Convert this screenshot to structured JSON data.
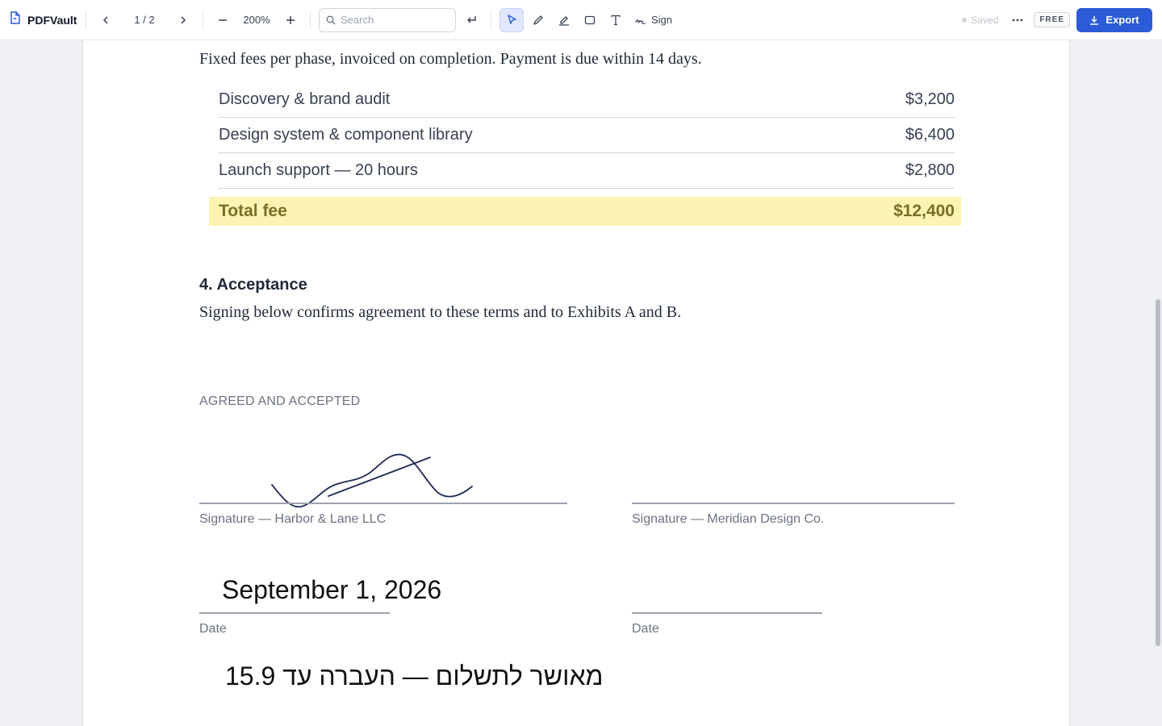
{
  "toolbar": {
    "app_name": "PDFVault",
    "page_indicator": "1 / 2",
    "zoom": "200%",
    "search_placeholder": "Search",
    "sign_label": "Sign",
    "saved_label": "Saved",
    "plan_badge": "FREE",
    "export_label": "Export",
    "icons": [
      "file-icon",
      "chevron-left-icon",
      "chevron-right-icon",
      "minus-icon",
      "plus-icon",
      "search-icon",
      "return-icon",
      "cursor-icon",
      "pen-icon",
      "highlighter-icon",
      "rectangle-icon",
      "text-icon",
      "signature-icon",
      "more-icon",
      "download-icon"
    ],
    "accent_color": "#2b5bd7"
  },
  "document": {
    "intro": "Fixed fees per phase, invoiced on completion. Payment is due within 14 days.",
    "fees": [
      {
        "label": "Discovery & brand audit",
        "amount": "$3,200"
      },
      {
        "label": "Design system & component library",
        "amount": "$6,400"
      },
      {
        "label": "Launch support — 20 hours",
        "amount": "$2,800"
      }
    ],
    "total": {
      "label": "Total fee",
      "amount": "$12,400"
    },
    "section_heading": "4. Acceptance",
    "section_text": "Signing below confirms agreement to these terms and to Exhibits A and B.",
    "agreed_heading": "AGREED AND ACCEPTED",
    "signature_left_caption": "Signature — Harbor & Lane LLC",
    "signature_right_caption": "Signature — Meridian Design Co.",
    "date_left_value": "September 1, 2026",
    "date_left_caption": "Date",
    "date_right_caption": "Date",
    "hebrew_note": "מאושר לתשלום — העברה עד 15.9"
  }
}
